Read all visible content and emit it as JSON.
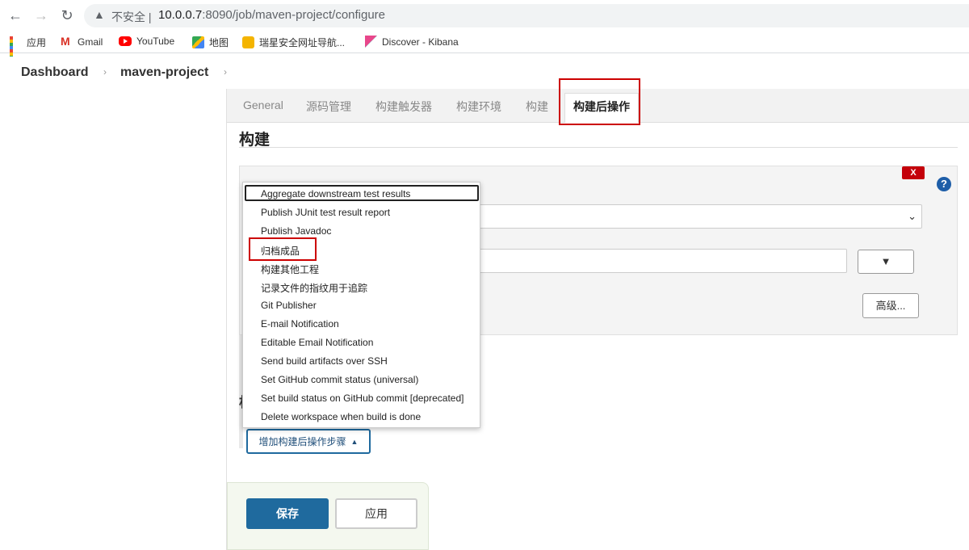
{
  "browser": {
    "insecure_label": "不安全",
    "url_host": "10.0.0.7",
    "url_rest": ":8090/job/maven-project/configure",
    "bookmarks": [
      {
        "label": "应用",
        "icon": "apps-grid-icon"
      },
      {
        "label": "Gmail",
        "icon": "gmail-icon"
      },
      {
        "label": "YouTube",
        "icon": "youtube-icon"
      },
      {
        "label": "地图",
        "icon": "maps-icon"
      },
      {
        "label": "瑞星安全网址导航...",
        "icon": "rising-icon"
      },
      {
        "label": "Discover - Kibana",
        "icon": "kibana-icon"
      }
    ]
  },
  "breadcrumb": {
    "items": [
      "Dashboard",
      "maven-project"
    ]
  },
  "tabs": [
    "General",
    "源码管理",
    "构建触发器",
    "构建环境",
    "构建",
    "构建后操作"
  ],
  "active_tab": "构建后操作",
  "section": {
    "title": "构建",
    "post_label_partial": "构"
  },
  "step": {
    "close_label": "X",
    "help_label": "?",
    "dropdown_button": "▼",
    "advanced_label": "高级..."
  },
  "menu": {
    "items": [
      "Aggregate downstream test results",
      "Publish JUnit test result report",
      "Publish Javadoc",
      "归档成品",
      "构建其他工程",
      "记录文件的指纹用于追踪",
      "Git Publisher",
      "E-mail Notification",
      "Editable Email Notification",
      "Send build artifacts over SSH",
      "Set GitHub commit status (universal)",
      "Set build status on GitHub commit [deprecated]",
      "Delete workspace when build is done"
    ],
    "highlighted_item": "归档成品"
  },
  "add_step_button": "增加构建后操作步骤",
  "actions": {
    "save": "保存",
    "apply": "应用"
  },
  "colors": {
    "accent_blue": "#1f6a9e",
    "highlight_red": "#cc0000",
    "close_red": "#c4000a"
  }
}
